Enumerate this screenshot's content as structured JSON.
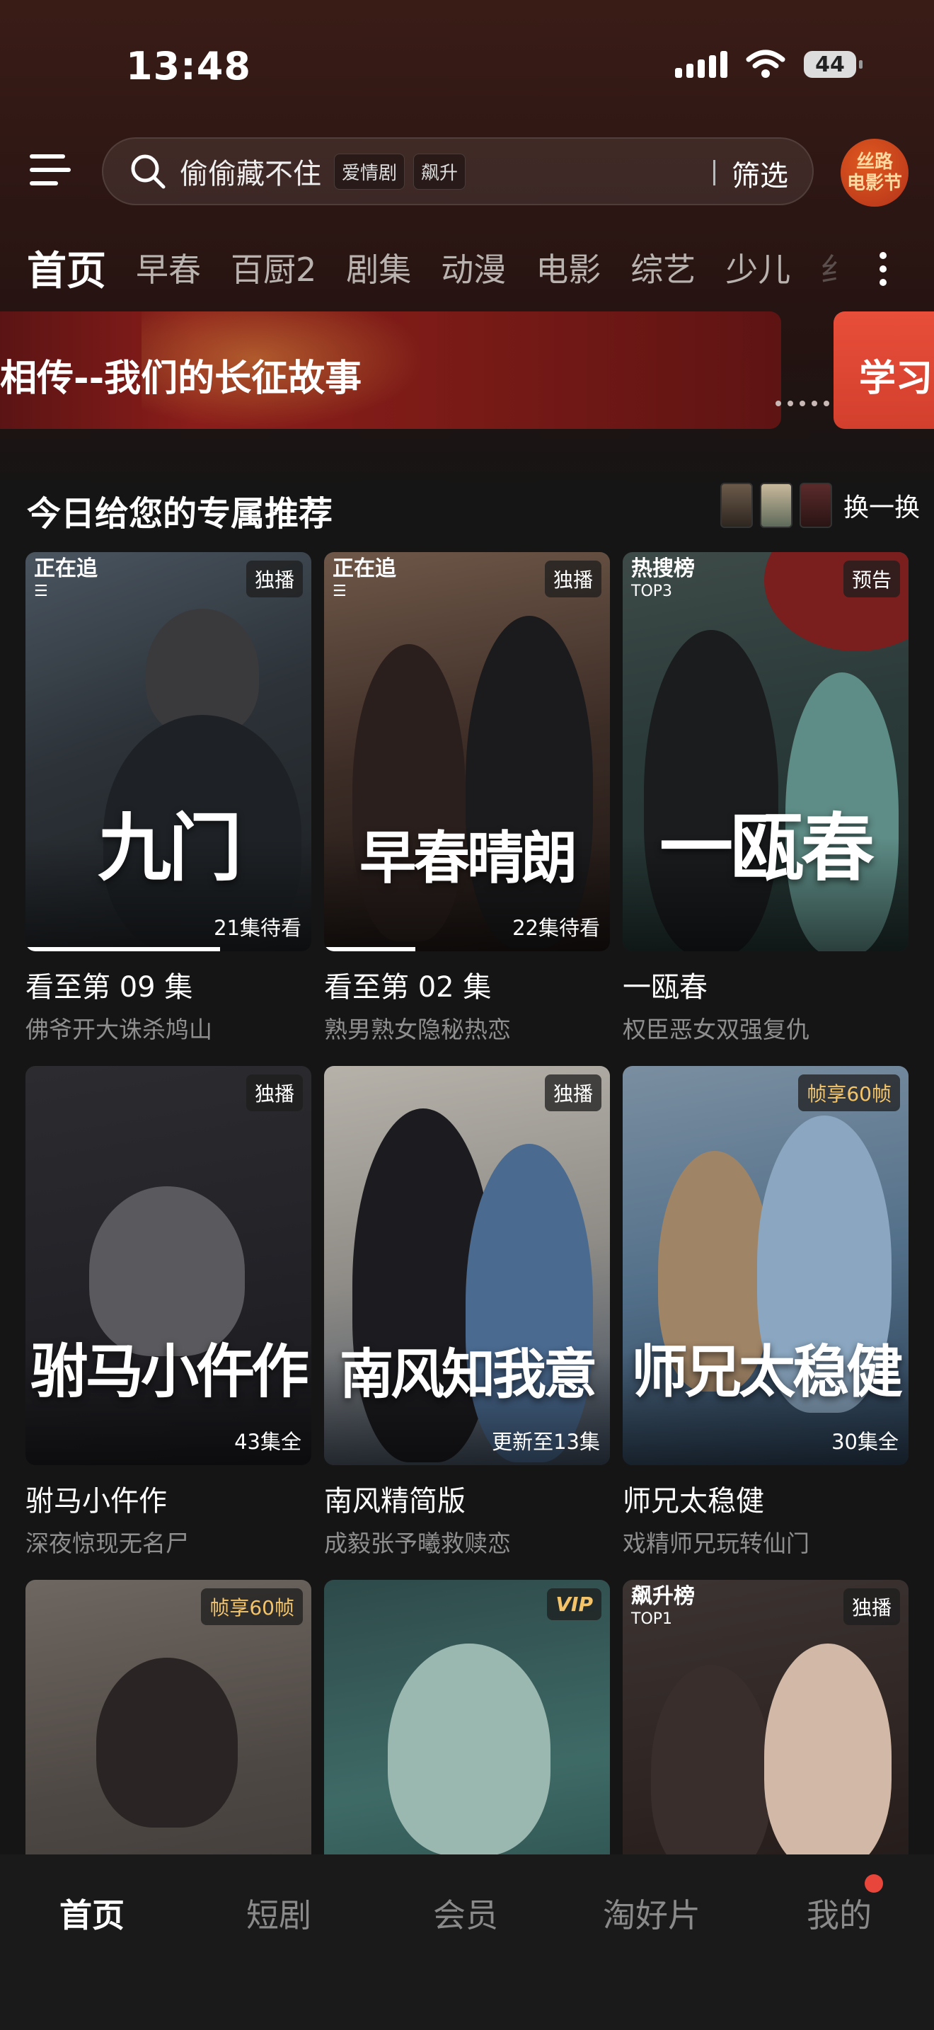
{
  "status": {
    "time": "13:48",
    "battery": "44"
  },
  "search": {
    "query": "偷偷藏不住",
    "tags": [
      "爱情剧",
      "飙升"
    ],
    "filter_label": "筛选",
    "festival_label_line1": "丝路",
    "festival_label_line2": "电影节"
  },
  "tabs": [
    "首页",
    "早春",
    "百厨2",
    "剧集",
    "动漫",
    "电影",
    "综艺",
    "少儿",
    "纟"
  ],
  "banner": {
    "main_text": "相传--我们的长征故事",
    "side_text": "学习"
  },
  "section": {
    "title": "今日给您的专属推荐",
    "swap_label": "换一换"
  },
  "cards": [
    {
      "badge_left": "正在追",
      "badge_right": "独播",
      "art": "九门",
      "episodes": "21集待看",
      "progress": 0.68,
      "title": "看至第 09 集",
      "subtitle": "佛爷开大诛杀鸠山"
    },
    {
      "badge_left": "正在追",
      "badge_right": "独播",
      "art": "早春晴朗",
      "episodes": "22集待看",
      "progress": 0.32,
      "title": "看至第 02 集",
      "subtitle": "熟男熟女隐秘热恋"
    },
    {
      "badge_left": "热搜榜",
      "badge_left_sub": "TOP3",
      "badge_right": "预告",
      "art": "一瓯春",
      "episodes": "",
      "title": "一瓯春",
      "subtitle": "权臣恶女双强复仇"
    },
    {
      "badge_right": "独播",
      "art": "驸马小仵作",
      "episodes": "43集全",
      "title": "驸马小仵作",
      "subtitle": "深夜惊现无名尸"
    },
    {
      "badge_right": "独播",
      "art": "南风知我意",
      "episodes": "更新至13集",
      "title": "南风精简版",
      "subtitle": "成毅张予曦救赎恋"
    },
    {
      "badge_right": "帧享60帧",
      "art": "师兄太稳健",
      "episodes": "30集全",
      "title": "师兄太稳健",
      "subtitle": "戏精师兄玩转仙门"
    },
    {
      "badge_right": "帧享60帧",
      "art": "",
      "episodes": "",
      "title": "",
      "subtitle": ""
    },
    {
      "badge_right": "VIP",
      "art": "",
      "episodes": "",
      "title": "",
      "subtitle": ""
    },
    {
      "badge_left": "飙升榜",
      "badge_left_sub": "TOP1",
      "badge_right": "独播",
      "art": "",
      "episodes": "",
      "title": "",
      "subtitle": ""
    }
  ],
  "bottom_nav": [
    "首页",
    "短剧",
    "会员",
    "淘好片",
    "我的"
  ],
  "colors": {
    "background": "#151515",
    "accent_red": "#e8463a",
    "gold": "#f3c46a"
  }
}
